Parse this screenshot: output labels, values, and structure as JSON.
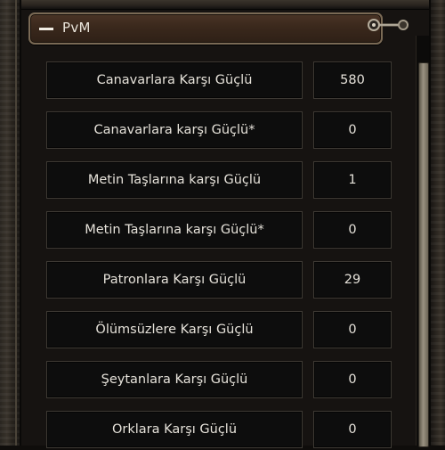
{
  "section": {
    "title": "PvM",
    "collapse_icon": "minus-icon",
    "pin_icon": "pin-icon"
  },
  "stats": [
    {
      "label": "Canavarlara Karşı Güçlü",
      "value": "580"
    },
    {
      "label": "Canavarlara karşı Güçlü*",
      "value": "0"
    },
    {
      "label": "Metin Taşlarına karşı Güçlü",
      "value": "1"
    },
    {
      "label": "Metin Taşlarına karşı Güçlü*",
      "value": "0"
    },
    {
      "label": "Patronlara Karşı Güçlü",
      "value": "29"
    },
    {
      "label": "Ölümsüzlere Karşı Güçlü",
      "value": "0"
    },
    {
      "label": "Şeytanlara Karşı Güçlü",
      "value": "0"
    },
    {
      "label": "Orklara Karşı Güçlü",
      "value": "0"
    }
  ],
  "colors": {
    "header_bg": "#3a281c",
    "header_border": "#7a6a55",
    "text": "#e6e2da",
    "cell_bg": "#0d0d0d"
  }
}
